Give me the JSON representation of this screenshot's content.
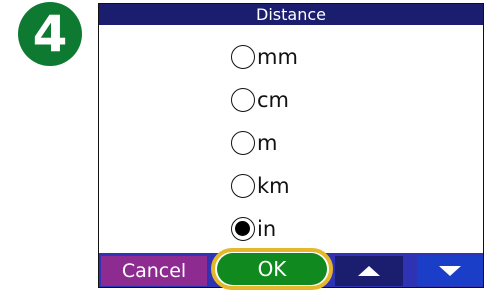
{
  "step": {
    "number": "4",
    "color": "#0e7a31"
  },
  "dialog": {
    "title": "Distance",
    "options": [
      {
        "label": "mm",
        "selected": false
      },
      {
        "label": "cm",
        "selected": false
      },
      {
        "label": "m",
        "selected": false
      },
      {
        "label": "km",
        "selected": false
      },
      {
        "label": "in",
        "selected": true
      }
    ]
  },
  "buttons": {
    "cancel_label": "Cancel",
    "ok_label": "OK",
    "up_icon": "triangle-up-icon",
    "down_icon": "triangle-down-icon"
  },
  "colors": {
    "title_bar": "#1b1d6f",
    "button_bar": "#2e32b3",
    "cancel": "#8d2b90",
    "ok": "#10891f",
    "highlight_ring": "#e4b82a"
  }
}
